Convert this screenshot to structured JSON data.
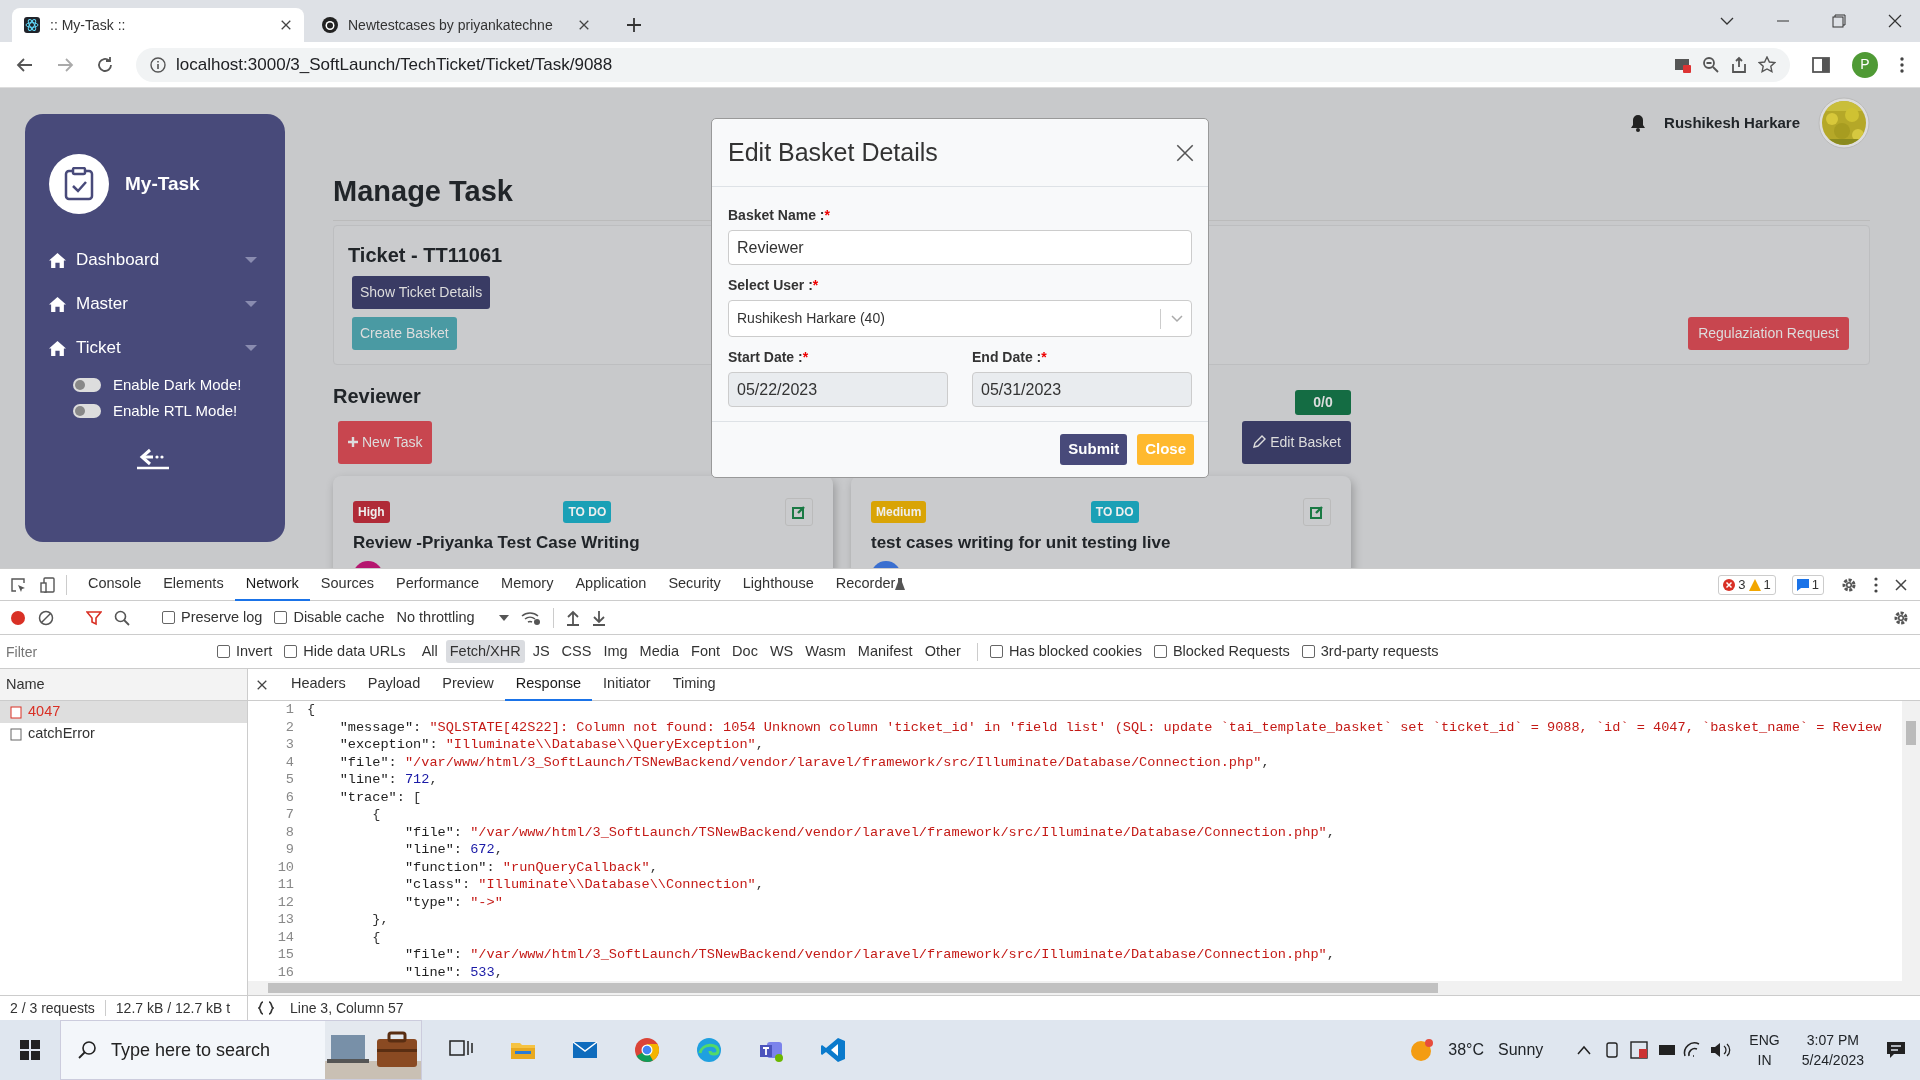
{
  "browser": {
    "tabs": [
      {
        "title": ":: My-Task ::",
        "selected": true
      },
      {
        "title": "Newtestcases by priyankatechne",
        "selected": false
      }
    ],
    "url": "localhost:3000/3_SoftLaunch/TechTicket/Ticket/Task/9088",
    "profile": "P"
  },
  "sidebar": {
    "brand": "My-Task",
    "items": [
      {
        "label": "Dashboard"
      },
      {
        "label": "Master"
      },
      {
        "label": "Ticket"
      }
    ],
    "toggles": [
      {
        "label": "Enable Dark Mode!",
        "on": false
      },
      {
        "label": "Enable RTL Mode!",
        "on": false
      }
    ]
  },
  "header": {
    "user": "Rushikesh Harkare"
  },
  "page_title": "Manage Task",
  "ticket": {
    "title": "Ticket - TT11061",
    "details_button": "Show Ticket Details",
    "create_button": "Create Basket",
    "request_button": "Regulaziation Request"
  },
  "basket": {
    "title": "Reviewer",
    "progress": "0/0",
    "new_task": "New Task",
    "edit": "Edit Basket"
  },
  "tasks": [
    {
      "priority": "High",
      "color": "#b02a37",
      "status": "TO DO",
      "title": "Review -Priyanka Test Case Writing"
    },
    {
      "priority": "Medium",
      "color": "#d9a406",
      "status": "TO DO",
      "title": "test cases writing for unit testing live"
    }
  ],
  "modal": {
    "title": "Edit Basket Details",
    "fields": [
      {
        "label": "Basket Name :",
        "required": "*",
        "kind": "text",
        "value": "Reviewer"
      },
      {
        "label": "Select User :",
        "required": "*",
        "kind": "select",
        "value": "Rushikesh Harkare (40)"
      },
      {
        "label": "Start Date :",
        "required": "*",
        "kind": "date",
        "value": "05/22/2023"
      },
      {
        "label": "End Date :",
        "required": "*",
        "kind": "date",
        "value": "05/31/2023"
      }
    ],
    "buttons": [
      {
        "label": "Submit",
        "kind": "primary"
      },
      {
        "label": "Close",
        "kind": "warning"
      }
    ]
  },
  "devtools": {
    "tabs": [
      {
        "label": "Console",
        "selected": false
      },
      {
        "label": "Elements",
        "selected": false
      },
      {
        "label": "Network",
        "selected": true
      },
      {
        "label": "Sources",
        "selected": false
      },
      {
        "label": "Performance",
        "selected": false
      },
      {
        "label": "Memory",
        "selected": false
      },
      {
        "label": "Application",
        "selected": false
      },
      {
        "label": "Security",
        "selected": false
      },
      {
        "label": "Lighthouse",
        "selected": false
      },
      {
        "label": "Recorder",
        "selected": false
      }
    ],
    "issues": {
      "errors": "3",
      "warnings": "1",
      "messages": "1"
    },
    "toolbar_checks": [
      {
        "label": "Preserve log",
        "checked": false
      },
      {
        "label": "Disable cache",
        "checked": false
      }
    ],
    "throttling": "No throttling",
    "filter_placeholder": "Filter",
    "filter_checks": [
      {
        "label": "Invert",
        "checked": false
      },
      {
        "label": "Hide data URLs",
        "checked": false
      }
    ],
    "types": [
      {
        "label": "All",
        "selected": false
      },
      {
        "label": "Fetch/XHR",
        "selected": true
      },
      {
        "label": "JS",
        "selected": false
      },
      {
        "label": "CSS",
        "selected": false
      },
      {
        "label": "Img",
        "selected": false
      },
      {
        "label": "Media",
        "selected": false
      },
      {
        "label": "Font",
        "selected": false
      },
      {
        "label": "Doc",
        "selected": false
      },
      {
        "label": "WS",
        "selected": false
      },
      {
        "label": "Wasm",
        "selected": false
      },
      {
        "label": "Manifest",
        "selected": false
      },
      {
        "label": "Other",
        "selected": false
      }
    ],
    "extra_checks": [
      {
        "label": "Has blocked cookies",
        "checked": false
      },
      {
        "label": "Blocked Requests",
        "checked": false
      },
      {
        "label": "3rd-party requests",
        "checked": false
      }
    ],
    "name_header": "Name",
    "requests": [
      {
        "name": "4047",
        "selected": true,
        "failed": true
      },
      {
        "name": "catchError",
        "selected": false,
        "failed": false
      }
    ],
    "detail_tabs": [
      {
        "label": "Headers",
        "selected": false
      },
      {
        "label": "Payload",
        "selected": false
      },
      {
        "label": "Preview",
        "selected": false
      },
      {
        "label": "Response",
        "selected": true
      },
      {
        "label": "Initiator",
        "selected": false
      },
      {
        "label": "Timing",
        "selected": false
      }
    ],
    "code": [
      {
        "n": "1",
        "text": "{"
      },
      {
        "n": "2",
        "text": "    \"message\": \"SQLSTATE[42S22]: Column not found: 1054 Unknown column 'ticket_id' in 'field list' (SQL: update `tai_template_basket` set `ticket_id` = 9088, `id` = 4047, `basket_name` = Review"
      },
      {
        "n": "3",
        "text": "    \"exception\": \"Illuminate\\\\Database\\\\QueryException\","
      },
      {
        "n": "4",
        "text": "    \"file\": \"/var/www/html/3_SoftLaunch/TSNewBackend/vendor/laravel/framework/src/Illuminate/Database/Connection.php\","
      },
      {
        "n": "5",
        "text": "    \"line\": 712,"
      },
      {
        "n": "6",
        "text": "    \"trace\": ["
      },
      {
        "n": "7",
        "text": "        {"
      },
      {
        "n": "8",
        "text": "            \"file\": \"/var/www/html/3_SoftLaunch/TSNewBackend/vendor/laravel/framework/src/Illuminate/Database/Connection.php\","
      },
      {
        "n": "9",
        "text": "            \"line\": 672,"
      },
      {
        "n": "10",
        "text": "            \"function\": \"runQueryCallback\","
      },
      {
        "n": "11",
        "text": "            \"class\": \"Illuminate\\\\Database\\\\Connection\","
      },
      {
        "n": "12",
        "text": "            \"type\": \"->\""
      },
      {
        "n": "13",
        "text": "        },"
      },
      {
        "n": "14",
        "text": "        {"
      },
      {
        "n": "15",
        "text": "            \"file\": \"/var/www/html/3_SoftLaunch/TSNewBackend/vendor/laravel/framework/src/Illuminate/Database/Connection.php\","
      },
      {
        "n": "16",
        "text": "            \"line\": 533,"
      }
    ],
    "status": {
      "requests": "2 / 3 requests",
      "transferred": "12.7 kB / 12.7 kB t",
      "position": "Line 3, Column 57"
    }
  },
  "taskbar": {
    "search_placeholder": "Type here to search",
    "temperature": "38°C",
    "weather": "Sunny",
    "lang": "ENG",
    "region": "IN",
    "time": "3:07 PM",
    "date": "5/24/2023"
  }
}
